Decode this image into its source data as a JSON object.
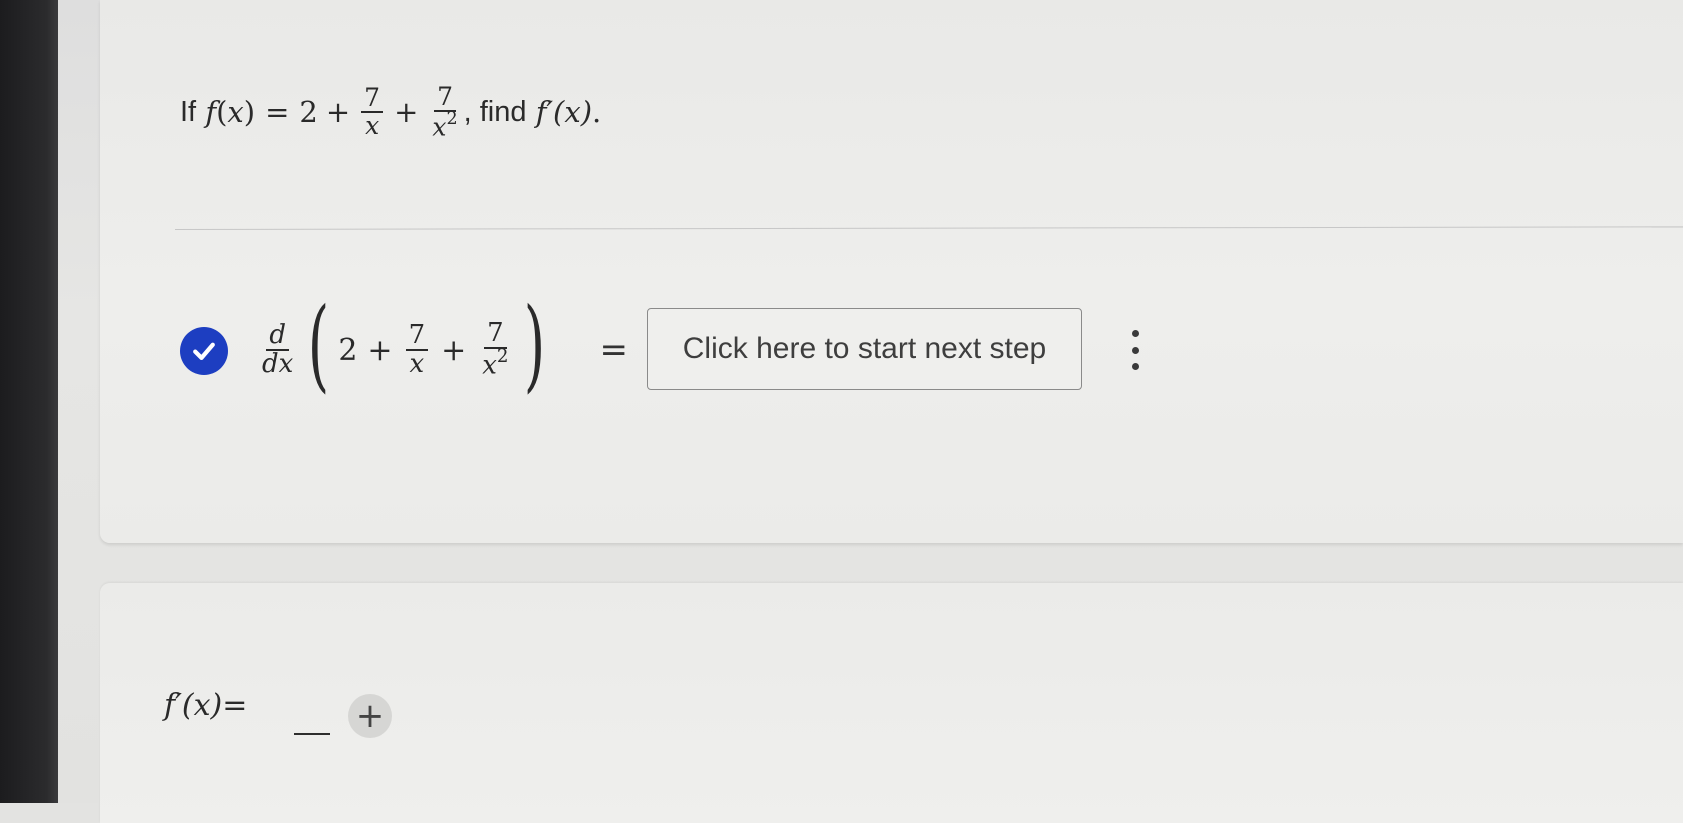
{
  "problem": {
    "prefix": "If",
    "fn": "f",
    "var": "x",
    "eq": "=",
    "constant": "2",
    "plus": "+",
    "term1_num": "7",
    "term1_den": "x",
    "term2_num": "7",
    "term2_den_base": "x",
    "term2_den_exp": "2",
    "suffix": ", find",
    "target": "f′(x)",
    "end": "."
  },
  "step": {
    "d_num": "d",
    "d_den": "dx",
    "constant": "2",
    "plus": "+",
    "term1_num": "7",
    "term1_den": "x",
    "term2_num": "7",
    "term2_den_base": "x",
    "term2_den_exp": "2",
    "equals": "=",
    "next_button": "Click here to start next step"
  },
  "answer": {
    "label": "f′(x)=",
    "add_button": "+"
  },
  "colors": {
    "check": "#1d3ec1",
    "bezel": "#1c1c1e"
  },
  "icons": {
    "check": "check-circle-icon",
    "menu": "kebab-menu-icon",
    "add": "plus-icon"
  }
}
